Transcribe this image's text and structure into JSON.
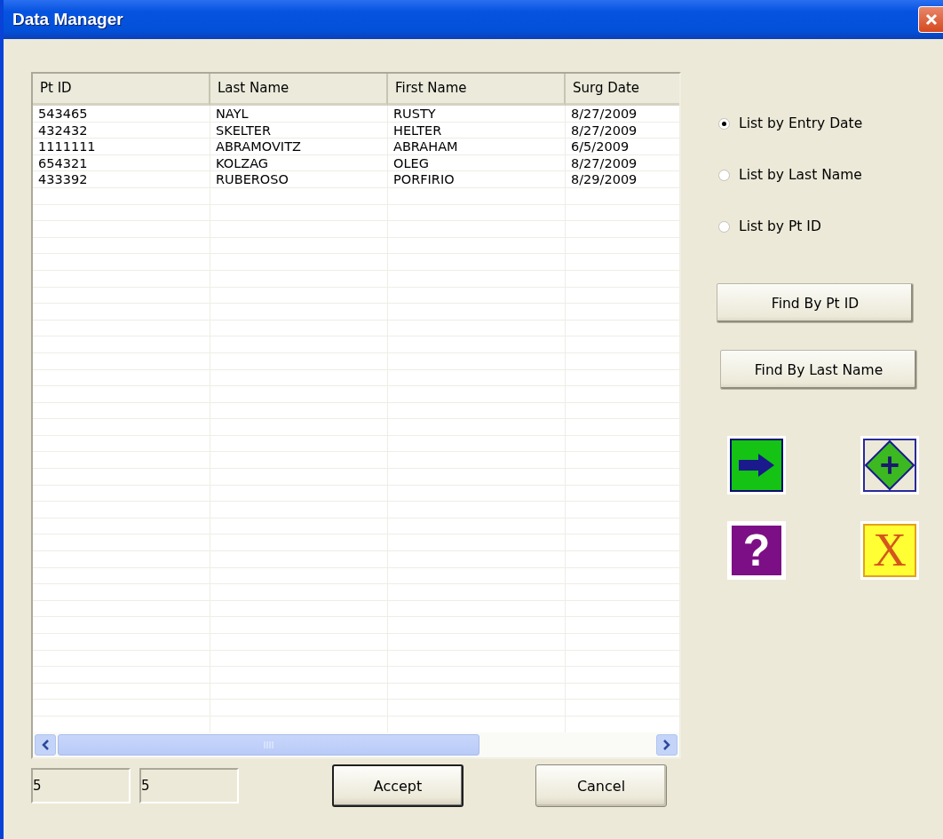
{
  "window": {
    "title": "Data Manager"
  },
  "table": {
    "columns": [
      "Pt ID",
      "Last Name",
      "First Name",
      "Surg Date"
    ],
    "rows": [
      [
        "543465",
        "NAYL",
        "RUSTY",
        "8/27/2009"
      ],
      [
        "432432",
        "SKELTER",
        "HELTER",
        "8/27/2009"
      ],
      [
        "1111111",
        "ABRAMOVITZ",
        "ABRAHAM",
        "6/5/2009"
      ],
      [
        "654321",
        "KOLZAG",
        "OLEG",
        "8/27/2009"
      ],
      [
        "433392",
        "RUBEROSO",
        "PORFIRIO",
        "8/29/2009"
      ]
    ]
  },
  "sort_options": [
    {
      "label": "List by Entry Date",
      "selected": true
    },
    {
      "label": "List by Last Name",
      "selected": false
    },
    {
      "label": "List by Pt ID",
      "selected": false
    }
  ],
  "find_buttons": [
    "Find By Pt ID",
    "Find By Last Name"
  ],
  "icon_buttons": [
    {
      "kind": "arrow"
    },
    {
      "kind": "add"
    },
    {
      "kind": "help",
      "glyph": "?"
    },
    {
      "kind": "delete",
      "glyph": "X"
    }
  ],
  "counters": [
    "5",
    "5"
  ],
  "buttons": [
    {
      "label": "Accept",
      "default": true
    },
    {
      "label": "Cancel",
      "default": false
    }
  ]
}
